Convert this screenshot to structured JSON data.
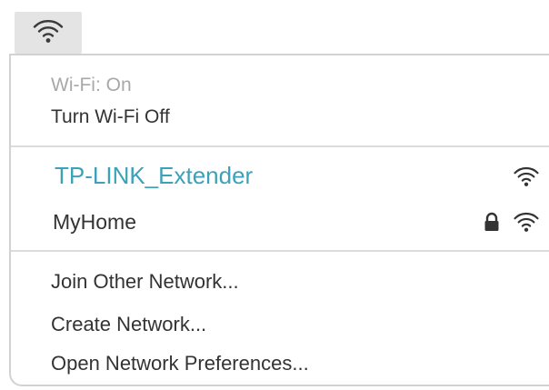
{
  "menubar": {
    "icon": "wifi-icon"
  },
  "wifi_menu": {
    "status_text": "Wi-Fi: On",
    "toggle_label": "Turn Wi-Fi Off",
    "networks": [
      {
        "name": "TP-LINK_Extender",
        "connected": true,
        "locked": false,
        "signal_icon": "wifi-signal-icon"
      },
      {
        "name": "MyHome",
        "connected": false,
        "locked": true,
        "lock_icon": "lock-icon",
        "signal_icon": "wifi-signal-icon"
      }
    ],
    "actions": {
      "join_other": "Join Other Network...",
      "create_network": "Create Network...",
      "open_preferences": "Open Network Preferences..."
    },
    "colors": {
      "connected_network": "#3da2b8",
      "status_text": "#a8a8a8",
      "text": "#333333"
    }
  }
}
